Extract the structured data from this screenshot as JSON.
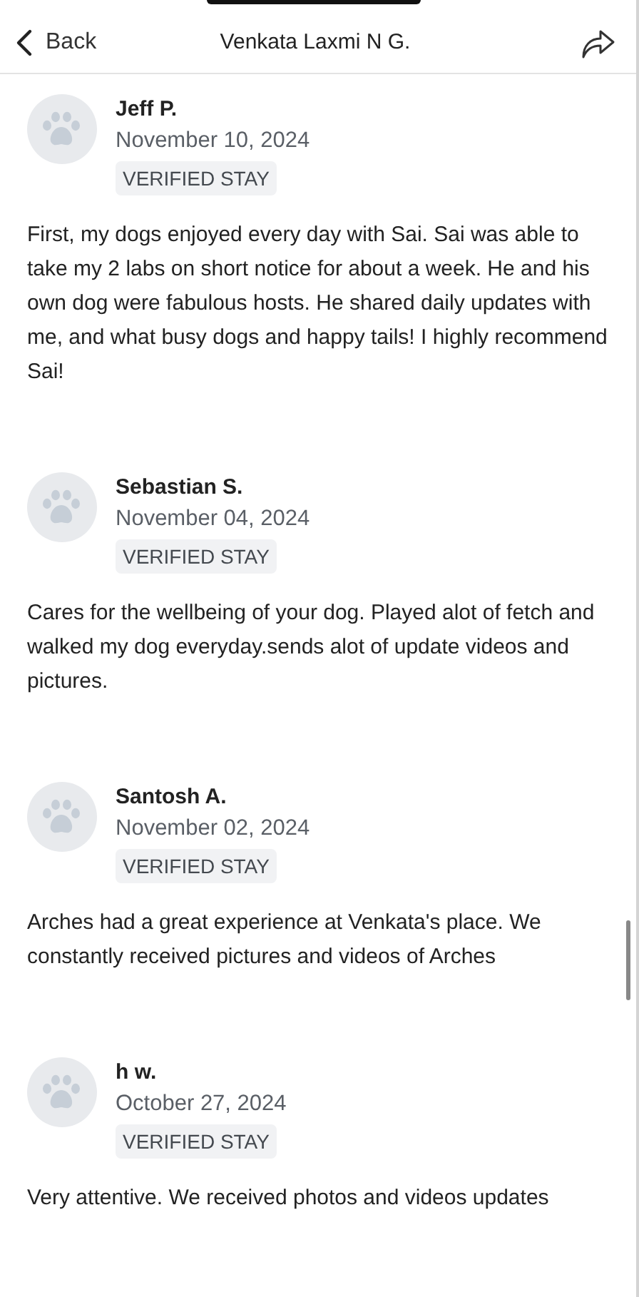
{
  "header": {
    "back": "Back",
    "title": "Venkata Laxmi N G."
  },
  "reviews": [
    {
      "name": "Jeff P.",
      "date": "November 10, 2024",
      "badge": "VERIFIED STAY",
      "text": "First, my dogs enjoyed every day with Sai. Sai was able to take my 2 labs on short notice for about a week. He and his own dog were fabulous hosts. He shared daily updates with me, and what busy dogs and happy tails! I highly recommend Sai!"
    },
    {
      "name": "Sebastian S.",
      "date": "November 04, 2024",
      "badge": "VERIFIED STAY",
      "text": "Cares for the wellbeing of your dog. Played alot of fetch and walked my dog everyday.sends alot of update  videos and pictures."
    },
    {
      "name": "Santosh A.",
      "date": "November 02, 2024",
      "badge": "VERIFIED STAY",
      "text": "Arches had a great experience at Venkata's place. We constantly received pictures and videos of Arches"
    },
    {
      "name": "h w.",
      "date": "October 27, 2024",
      "badge": "VERIFIED STAY",
      "text": "Very attentive. We received photos and videos updates"
    }
  ]
}
